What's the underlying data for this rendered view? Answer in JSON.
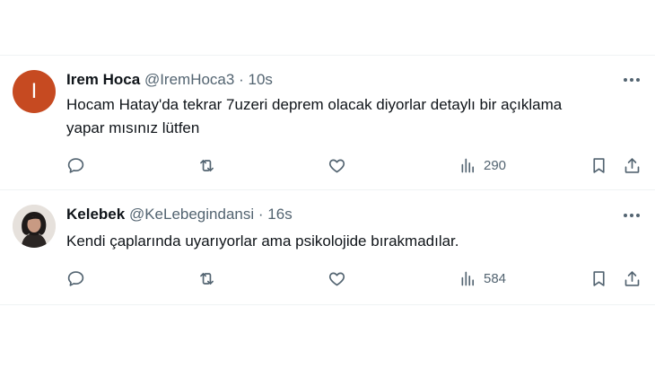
{
  "tweets": [
    {
      "avatar_letter": "I",
      "name": "Irem Hoca",
      "handle": "@IremHoca3",
      "separator": "·",
      "time": "10s",
      "text_line1": "Hocam Hatay'da tekrar 7uzeri deprem olacak diyorlar detaylı bir açıklama",
      "text_line2": "yapar mısınız lütfen",
      "views": "290",
      "avatar_color": "#c64a21"
    },
    {
      "name": "Kelebek",
      "handle": "@KeLebegindansi",
      "separator": "·",
      "time": "16s",
      "text_line1": "Kendi çaplarında uyarıyorlar ama psikolojide bırakmadılar.",
      "views": "584"
    }
  ],
  "icons": [
    "reply-icon",
    "retweet-icon",
    "like-icon",
    "views-icon",
    "bookmark-icon",
    "share-icon",
    "more-icon"
  ]
}
